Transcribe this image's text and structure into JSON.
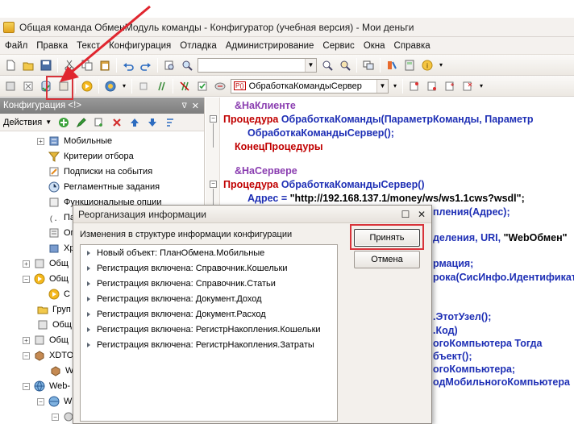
{
  "window": {
    "title": "Общая команда ОбменМодуль команды - Конфигуратор (учебная версия) - Мои деньги"
  },
  "menu": [
    "Файл",
    "Правка",
    "Текст",
    "Конфигурация",
    "Отладка",
    "Администрирование",
    "Сервис",
    "Окна",
    "Справка"
  ],
  "toolbar2": {
    "procedure_select": "ОбработкаКомандыСервер",
    "proc_badge": "P()"
  },
  "left_panel": {
    "title": "Конфигурация <!>",
    "actions_label": "Действия",
    "tree": [
      "Мобильные",
      "Критерии отбора",
      "Подписки на события",
      "Регламентные задания",
      "Функциональные опции",
      "Пара",
      "Опре",
      "Хран",
      "Общ",
      "Общ",
      "С",
      "Груп",
      "Общ",
      "Общ",
      "XDTO",
      "W",
      "Web-",
      "W"
    ]
  },
  "code": {
    "l1": "&НаКлиенте",
    "l2_kw": "Процедура",
    "l2_rest": " ОбработкаКоманды(ПараметрКоманды, Параметр",
    "l3": "ОбработкаКомандыСервер();",
    "l4": "КонецПроцедуры",
    "l5": "&НаСервере",
    "l6_kw": "Процедура",
    "l6_rest": " ОбработкаКомандыСервер()",
    "l7_id": "Адрес",
    "l7_op": " = ",
    "l7_str": "\"http://192.168.137.1/money/ws/ws1.1cws?wsdl\";",
    "l8": "пления(Адрес);",
    "l9a": "деления, URI, ",
    "l9b": "\"WebОбмен\"",
    "l10": "рмация;",
    "l11": "рока(СисИнфо.Идентификат",
    "l12": ".ЭтотУзел();",
    "l13": ".Код)",
    "l14": "огоКомпьютера Тогда",
    "l15": "бъект();",
    "l16": "огоКомпьютера;",
    "l17": "одМобильногоКомпьютера"
  },
  "dialog": {
    "title": "Реорганизация информации",
    "subtitle": "Изменения в структуре информации конфигурации",
    "accept": "Принять",
    "cancel": "Отмена",
    "items": [
      "Новый объект: ПланОбмена.Мобильные",
      "Регистрация включена: Справочник.Кошельки",
      "Регистрация включена: Справочник.Статьи",
      "Регистрация включена: Документ.Доход",
      "Регистрация включена: Документ.Расход",
      "Регистрация включена: РегистрНакопления.Кошельки",
      "Регистрация включена: РегистрНакопления.Затраты"
    ]
  }
}
